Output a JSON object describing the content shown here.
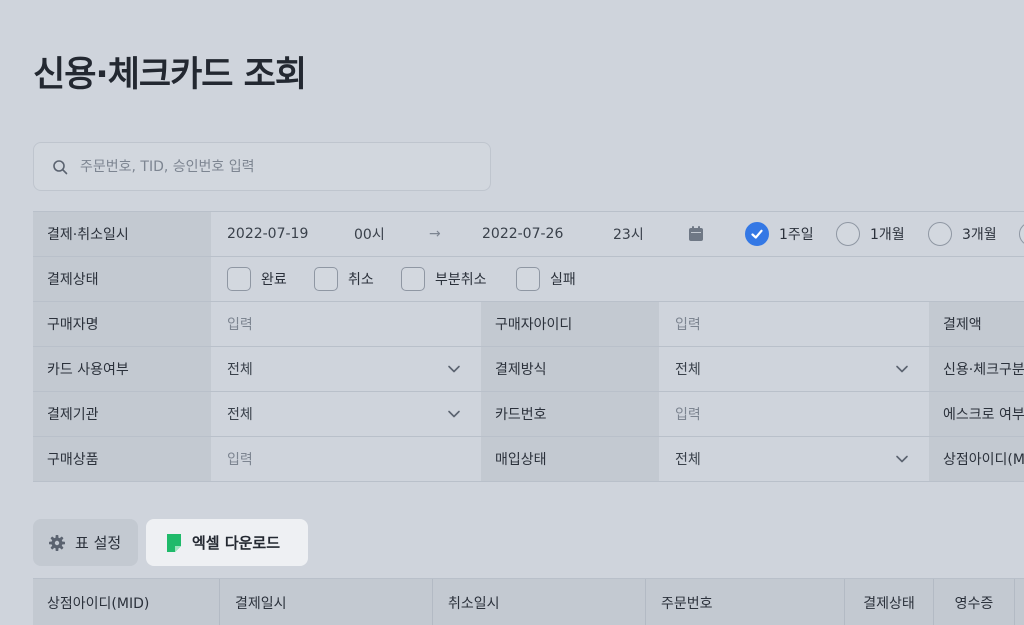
{
  "page": {
    "title": "신용·체크카드 조회"
  },
  "search": {
    "placeholder": "주문번호, TID, 승인번호 입력",
    "value": ""
  },
  "filters": {
    "datetime": {
      "label": "결제·취소일시",
      "start_date": "2022-07-19",
      "start_hour": "00시",
      "arrow": "→",
      "end_date": "2022-07-26",
      "end_hour": "23시",
      "periods": [
        {
          "label": "1주일",
          "selected": true
        },
        {
          "label": "1개월",
          "selected": false
        },
        {
          "label": "3개월",
          "selected": false
        }
      ]
    },
    "status": {
      "label": "결제상태",
      "options": [
        {
          "label": "완료",
          "checked": false
        },
        {
          "label": "취소",
          "checked": false
        },
        {
          "label": "부분취소",
          "checked": false
        },
        {
          "label": "실패",
          "checked": false
        }
      ]
    },
    "rows": [
      [
        {
          "label": "구매자명",
          "value": "입력",
          "kind": "input"
        },
        {
          "label": "구매자아이디",
          "value": "입력",
          "kind": "input"
        },
        {
          "label": "결제액"
        }
      ],
      [
        {
          "label": "카드 사용여부",
          "value": "전체",
          "kind": "select"
        },
        {
          "label": "결제방식",
          "value": "전체",
          "kind": "select"
        },
        {
          "label": "신용·체크구분"
        }
      ],
      [
        {
          "label": "결제기관",
          "value": "전체",
          "kind": "select"
        },
        {
          "label": "카드번호",
          "value": "입력",
          "kind": "input"
        },
        {
          "label": "에스크로 여부"
        }
      ],
      [
        {
          "label": "구매상품",
          "value": "입력",
          "kind": "input"
        },
        {
          "label": "매입상태",
          "value": "전체",
          "kind": "select"
        },
        {
          "label": "상점아이디(MID)"
        }
      ]
    ]
  },
  "toolbar": {
    "settings_label": "표 설정",
    "excel_label": "엑셀 다운로드"
  },
  "table": {
    "columns": [
      "상점아이디(MID)",
      "결제일시",
      "취소일시",
      "주문번호",
      "결제상태",
      "영수증"
    ]
  },
  "colors": {
    "accent": "#3478e5",
    "excel": "#1fba6a",
    "background": "#cfd4dc"
  }
}
